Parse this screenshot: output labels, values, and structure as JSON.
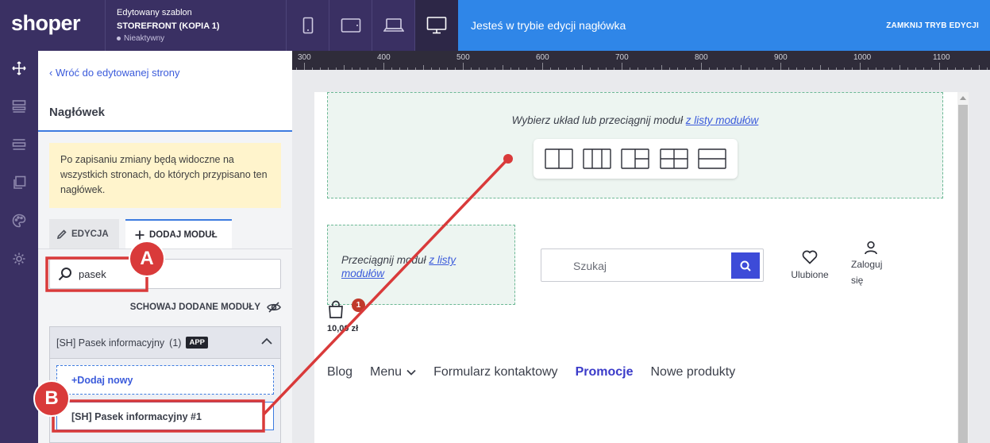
{
  "app": {
    "logo": "shoper"
  },
  "template": {
    "heading": "Edytowany szablon",
    "name": "STOREFRONT (KOPIA 1)",
    "status": "Nieaktywny"
  },
  "devices": [
    {
      "name": "mobile",
      "icon": "phone-icon"
    },
    {
      "name": "tablet",
      "icon": "tablet-icon"
    },
    {
      "name": "laptop",
      "icon": "laptop-icon"
    },
    {
      "name": "desktop",
      "icon": "desktop-icon",
      "active": true
    }
  ],
  "editbar": {
    "message": "Jesteś w trybie edycji nagłówka",
    "close_label": "ZAMKNIJ TRYB EDYCJI",
    "color": "#2f86e8"
  },
  "rail": {
    "icons": [
      "move-icon",
      "sections-icon",
      "layers-icon",
      "pages-icon",
      "palette-icon",
      "settings-icon"
    ]
  },
  "panel": {
    "back_link": "Wróć do edytowanej strony",
    "title": "Nagłówek",
    "notice": "Po zapisaniu zmiany będą widoczne na wszystkich stronach, do których przypisano ten nagłówek.",
    "tabs": {
      "edit": "EDYCJA",
      "add": "DODAJ MODUŁ"
    },
    "search_value": "pasek",
    "hide_added": "SCHOWAJ DODANE MODUŁY",
    "module_group": {
      "name": "[SH] Pasek informacyjny",
      "count": "(1)",
      "badge": "APP",
      "add_new": "+Dodaj nowy",
      "item": "[SH] Pasek informacyjny #1"
    }
  },
  "ruler": {
    "labels": [
      "300",
      "400",
      "500",
      "600",
      "700",
      "800",
      "900",
      "1000",
      "1100"
    ]
  },
  "canvas": {
    "dropzone_main_text": "Wybierz układ lub przeciągnij moduł ",
    "dropzone_main_link": "z listy modułów",
    "dropzone_small_text": "Przeciągnij moduł ",
    "dropzone_small_link": "z listy modułów",
    "layout_icons": [
      "layout-2col-icon",
      "layout-3col-icon",
      "layout-grid-split-icon",
      "layout-4grid-icon",
      "layout-2row-icon"
    ],
    "search_placeholder": "Szukaj",
    "favorites": "Ulubione",
    "login": "Zaloguj się",
    "cart_count": "1",
    "cart_price": "10,00 zł",
    "nav": [
      "Blog",
      "Menu",
      "Formularz kontaktowy",
      "Promocje",
      "Nowe produkty"
    ]
  },
  "annotations": {
    "a": "A",
    "b": "B",
    "color": "#d93a3a"
  }
}
